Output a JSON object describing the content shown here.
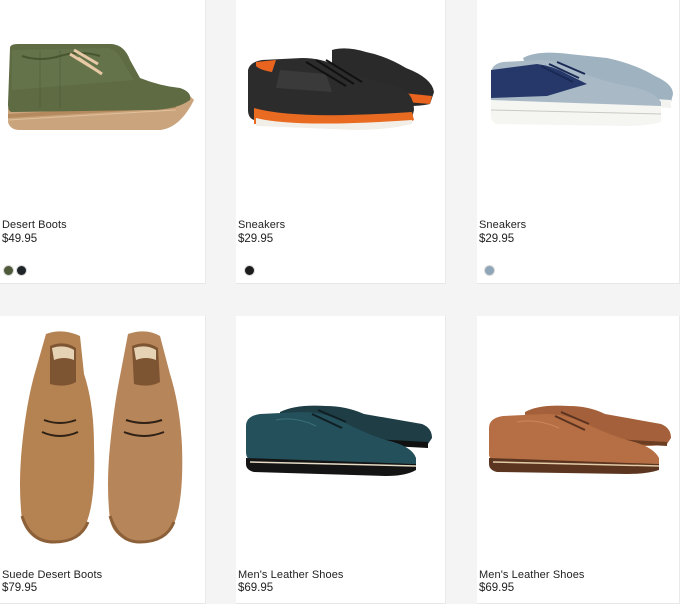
{
  "products": [
    {
      "name": "Desert Boots",
      "price": "$49.95",
      "swatches": [
        "#4f5a3a",
        "#1e2428"
      ]
    },
    {
      "name": "Sneakers",
      "price": "$29.95",
      "swatches": [
        "#1c1c1c"
      ]
    },
    {
      "name": "Sneakers",
      "price": "$29.95",
      "swatches": [
        "#8fa6b8"
      ]
    },
    {
      "name": "Suede Desert Boots",
      "price": "$79.95",
      "swatches": []
    },
    {
      "name": "Men's Leather Shoes",
      "price": "$69.95",
      "swatches": []
    },
    {
      "name": "Men's Leather Shoes",
      "price": "$69.95",
      "swatches": []
    }
  ],
  "image_icons": [
    "desert-boot-icon",
    "black-sneaker-icon",
    "denim-sneaker-icon",
    "suede-boots-pair-icon",
    "teal-oxford-pair-icon",
    "tan-oxford-pair-icon"
  ]
}
